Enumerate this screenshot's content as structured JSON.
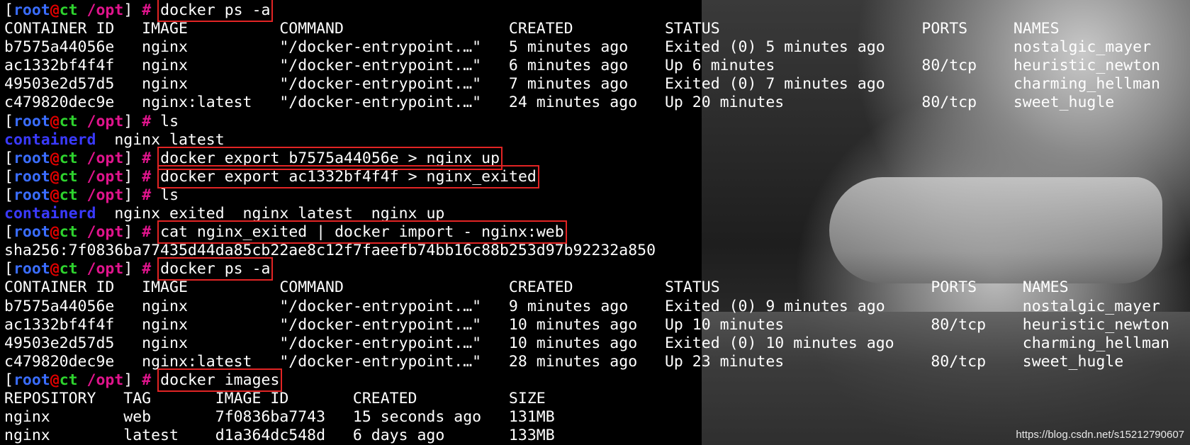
{
  "prompt": {
    "lb": "[",
    "user": "root",
    "at": "@",
    "host": "ct",
    "path": "/opt",
    "rb": "]",
    "hash": "#"
  },
  "lines": [
    {
      "type": "prompt",
      "cmd": "docker ps -a",
      "boxed": true
    },
    {
      "type": "out",
      "text": "CONTAINER ID   IMAGE          COMMAND                  CREATED          STATUS                      PORTS     NAMES"
    },
    {
      "type": "out",
      "text": "b7575a44056e   nginx          \"/docker-entrypoint.…\"   5 minutes ago    Exited (0) 5 minutes ago              nostalgic_mayer"
    },
    {
      "type": "out",
      "text": "ac1332bf4f4f   nginx          \"/docker-entrypoint.…\"   6 minutes ago    Up 6 minutes                80/tcp    heuristic_newton"
    },
    {
      "type": "out",
      "text": "49503e2d57d5   nginx          \"/docker-entrypoint.…\"   7 minutes ago    Exited (0) 7 minutes ago              charming_hellman"
    },
    {
      "type": "out",
      "text": "c479820dec9e   nginx:latest   \"/docker-entrypoint.…\"   24 minutes ago   Up 20 minutes               80/tcp    sweet_hugle"
    },
    {
      "type": "prompt",
      "cmd": "ls",
      "boxed": false
    },
    {
      "type": "ls",
      "dir": "containerd",
      "rest": "  nginx_latest"
    },
    {
      "type": "prompt",
      "cmd": "docker export b7575a44056e > nginx_up",
      "boxed": true
    },
    {
      "type": "prompt",
      "cmd": "docker export ac1332bf4f4f > nginx_exited",
      "boxed": true
    },
    {
      "type": "prompt",
      "cmd": "ls",
      "boxed": false
    },
    {
      "type": "ls",
      "dir": "containerd",
      "rest": "  nginx_exited  nginx_latest  nginx_up"
    },
    {
      "type": "prompt",
      "cmd": "cat nginx_exited | docker import - nginx:web",
      "boxed": true
    },
    {
      "type": "out",
      "text": "sha256:7f0836ba77435d44da85cb22ae8c12f7faeefb74bb16c88b253d97b92232a850"
    },
    {
      "type": "prompt",
      "cmd": "docker ps -a",
      "boxed": true
    },
    {
      "type": "out",
      "text": "CONTAINER ID   IMAGE          COMMAND                  CREATED          STATUS                       PORTS     NAMES"
    },
    {
      "type": "out",
      "text": "b7575a44056e   nginx          \"/docker-entrypoint.…\"   9 minutes ago    Exited (0) 9 minutes ago               nostalgic_mayer"
    },
    {
      "type": "out",
      "text": "ac1332bf4f4f   nginx          \"/docker-entrypoint.…\"   10 minutes ago   Up 10 minutes                80/tcp    heuristic_newton"
    },
    {
      "type": "out",
      "text": "49503e2d57d5   nginx          \"/docker-entrypoint.…\"   10 minutes ago   Exited (0) 10 minutes ago              charming_hellman"
    },
    {
      "type": "out",
      "text": "c479820dec9e   nginx:latest   \"/docker-entrypoint.…\"   28 minutes ago   Up 23 minutes                80/tcp    sweet_hugle"
    },
    {
      "type": "prompt",
      "cmd": "docker images",
      "boxed": true
    },
    {
      "type": "out",
      "text": "REPOSITORY   TAG       IMAGE ID       CREATED          SIZE"
    },
    {
      "type": "out",
      "text": "nginx        web       7f0836ba7743   15 seconds ago   131MB"
    },
    {
      "type": "out",
      "text": "nginx        latest    d1a364dc548d   6 days ago       133MB"
    }
  ],
  "watermark": "https://blog.csdn.net/s15212790607"
}
